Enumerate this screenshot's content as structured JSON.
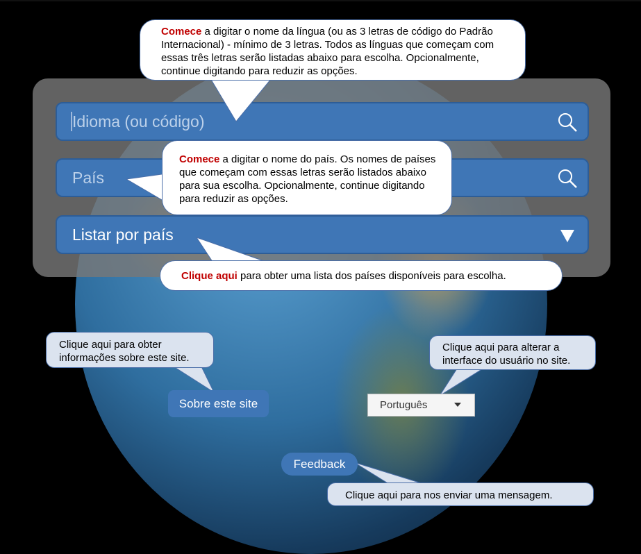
{
  "search": {
    "language_placeholder": "Idioma (ou código)",
    "country_placeholder": "País",
    "list_by_country_label": "Listar por país"
  },
  "callouts": {
    "language": {
      "highlight": "Comece",
      "text": " a digitar o nome da língua (ou as 3 letras de código do Padrão Internacional) - mínimo de 3 letras. Todos as línguas que começam com essas três letras serão listadas abaixo para escolha. Opcionalmente, continue digitando para reduzir as opções."
    },
    "country": {
      "highlight": "Comece",
      "text": " a digitar o nome do país. Os nomes de países que começam com essas letras serão listados abaixo para sua escolha. Opcionalmente, continue digitando para reduzir as opções."
    },
    "list": {
      "highlight": "Clique aqui",
      "text": " para obter uma lista dos países disponíveis para escolha."
    },
    "about": "Clique aqui para obter informações sobre este site.",
    "interface": "Clique aqui para alterar a interface do usuário no site.",
    "feedback": "Clique aqui para nos enviar uma mensagem."
  },
  "buttons": {
    "about": "Sobre este site",
    "feedback": "Feedback"
  },
  "ui_language": {
    "selected": "Português"
  },
  "icons": [
    "search-icon",
    "dropdown-arrow-icon",
    "caret-down-icon"
  ]
}
